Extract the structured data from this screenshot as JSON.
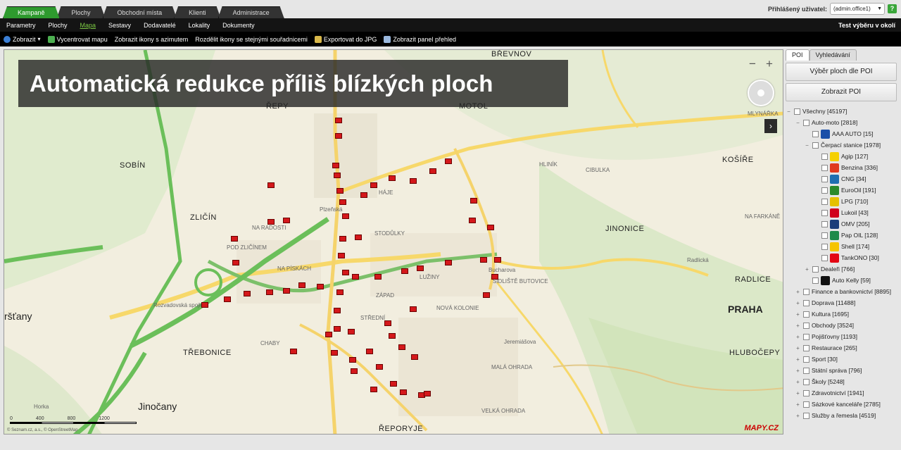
{
  "main_tabs": [
    "Kampaně",
    "Plochy",
    "Obchodní místa",
    "Klienti",
    "Administrace"
  ],
  "user": {
    "label": "Přihlášený uživatel:",
    "value": "(admin.office1)",
    "help": "?"
  },
  "subnav": {
    "items": [
      "Parametry",
      "Plochy",
      "Mapa",
      "Sestavy",
      "Dodavatelé",
      "Lokality",
      "Dokumenty"
    ],
    "active": "Mapa",
    "right": "Test výběru v okolí"
  },
  "toolbar": [
    "Zobrazit",
    "Vycentrovat mapu",
    "Zobrazit ikony s azimutem",
    "Rozdělit ikony se stejnými souřadnicemi",
    "Exportovat do JPG",
    "Zobrazit panel přehled"
  ],
  "banner": "Automatická redukce příliš blízkých ploch",
  "map": {
    "zoom_minus": "−",
    "zoom_plus": "+",
    "arrow": "›",
    "scale": [
      "0",
      "400",
      "800",
      "1200"
    ],
    "copyright": "© Seznam.cz, a.s., © OpenStreetMap",
    "logo": "MAPY.CZ",
    "labels": {
      "repy": "ŘEPY",
      "motol": "MOTOL",
      "sobin": "SOBÍN",
      "zlicin": "ZLIČÍN",
      "jinonice": "JINONICE",
      "kosire": "KOŠÍŘE",
      "radlice": "RADLICE",
      "praha": "PRAHA",
      "trebonice": "TŘEBONICE",
      "jinocany": "Jinočany",
      "hlubocepy": "HLUBOČEPY",
      "rastany": "ršťany",
      "reporyje": "ŘEPORYJE",
      "brevnov": "BŘEVNOV",
      "stodulky": "STODŮLKY",
      "zapad": "ZÁPAD",
      "luziny": "LUŽINY",
      "butovice": "SIDLIŠTĚ BUTOVICE",
      "na_radosti": "NA RADOSTI",
      "pod_zlicinem": "POD ZLIČÍNEM",
      "na_piskach": "NA PÍSKÁCH",
      "chaby": "CHABY",
      "haje": "HÁJE",
      "stredni": "STŘEDNÍ",
      "nova_kolonie": "NOVÁ KOLONIE",
      "mala_ohrada": "MALÁ OHRADA",
      "velka_ohrada": "VELKÁ OHRADA",
      "hlinik": "HLINÍK",
      "cibulka": "CIBULKA",
      "na_farkane": "NA FARKÁNĚ",
      "horka": "Horka",
      "mlynarka": "MLYNÁŘKA",
      "bucharova": "Bucharova",
      "jeremiasova": "Jeremiášova",
      "plzenska": "Plzeňská",
      "rozvadovska": "Rozvadovská spojka",
      "radlicka": "Radlická"
    }
  },
  "panel": {
    "tabs": [
      "POI",
      "Vyhledávání"
    ],
    "buttons": [
      "Výběr ploch dle POI",
      "Zobrazit POI"
    ],
    "tree": [
      {
        "label": "Všechny [45197]",
        "level": 0,
        "exp": "−"
      },
      {
        "label": "Auto-moto [2818]",
        "level": 1,
        "exp": "−"
      },
      {
        "label": "AAA AUTO [15]",
        "level": 2,
        "icon": "aaa-auto-icon",
        "color": "#1a4fa8"
      },
      {
        "label": "Čerpací stanice [1978]",
        "level": 2,
        "exp": "−"
      },
      {
        "label": "Agip [127]",
        "level": 3,
        "icon": "agip-icon",
        "color": "#f5d000"
      },
      {
        "label": "Benzina [336]",
        "level": 3,
        "icon": "benzina-icon",
        "color": "#e03a1e"
      },
      {
        "label": "CNG [34]",
        "level": 3,
        "icon": "cng-icon",
        "color": "#1f6fb0"
      },
      {
        "label": "EuroOil [191]",
        "level": 3,
        "icon": "eurooil-icon",
        "color": "#2a8a2a"
      },
      {
        "label": "LPG [710]",
        "level": 3,
        "icon": "lpg-icon",
        "color": "#e5c100"
      },
      {
        "label": "Lukoil [43]",
        "level": 3,
        "icon": "lukoil-icon",
        "color": "#d0021b"
      },
      {
        "label": "OMV [205]",
        "level": 3,
        "icon": "omv-icon",
        "color": "#1b3d7a"
      },
      {
        "label": "Pap OIL [128]",
        "level": 3,
        "icon": "papoil-icon",
        "color": "#1e8a4a"
      },
      {
        "label": "Shell [174]",
        "level": 3,
        "icon": "shell-icon",
        "color": "#f5c400"
      },
      {
        "label": "TankONO [30]",
        "level": 3,
        "icon": "tankono-icon",
        "color": "#e30613"
      },
      {
        "label": "Dealeři [766]",
        "level": 2,
        "exp": "+"
      },
      {
        "label": "Auto Kelly [59]",
        "level": 2,
        "icon": "autokelly-icon",
        "color": "#111"
      },
      {
        "label": "Finance a bankovnictví [8895]",
        "level": 1,
        "exp": "+"
      },
      {
        "label": "Doprava [11488]",
        "level": 1,
        "exp": "+"
      },
      {
        "label": "Kultura [1695]",
        "level": 1,
        "exp": "+"
      },
      {
        "label": "Obchody [3524]",
        "level": 1,
        "exp": "+"
      },
      {
        "label": "Pojišťovny [1193]",
        "level": 1,
        "exp": "+"
      },
      {
        "label": "Restaurace [265]",
        "level": 1,
        "exp": "+"
      },
      {
        "label": "Sport [30]",
        "level": 1,
        "exp": "+"
      },
      {
        "label": "Státní správa [796]",
        "level": 1,
        "exp": "+"
      },
      {
        "label": "Školy [5248]",
        "level": 1,
        "exp": "+"
      },
      {
        "label": "Zdravotnictví [1941]",
        "level": 1,
        "exp": "+"
      },
      {
        "label": "Sázkové kanceláře [2785]",
        "level": 1,
        "exp": "+"
      },
      {
        "label": "Služby a řemesla [4519]",
        "level": 1,
        "exp": "+"
      }
    ]
  }
}
